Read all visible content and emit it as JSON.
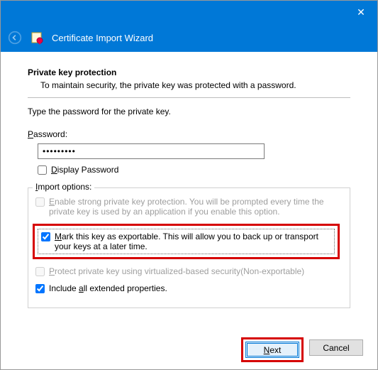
{
  "titlebar": {
    "close": "✕"
  },
  "nav": {
    "title": "Certificate Import Wizard"
  },
  "heading": "Private key protection",
  "subheading": "To maintain security, the private key was protected with a password.",
  "prompt": "Type the password for the private key.",
  "password": {
    "label": "Password:",
    "value": "•••••••••",
    "display_label": "Display Password"
  },
  "options": {
    "legend": "Import options:",
    "strong": "Enable strong private key protection. You will be prompted every time the private key is used by an application if you enable this option.",
    "exportable": "Mark this key as exportable. This will allow you to back up or transport your keys at a later time.",
    "virtualized": "Protect private key using virtualized-based security(Non-exportable)",
    "extended": "Include all extended properties."
  },
  "buttons": {
    "next": "Next",
    "cancel": "Cancel"
  }
}
